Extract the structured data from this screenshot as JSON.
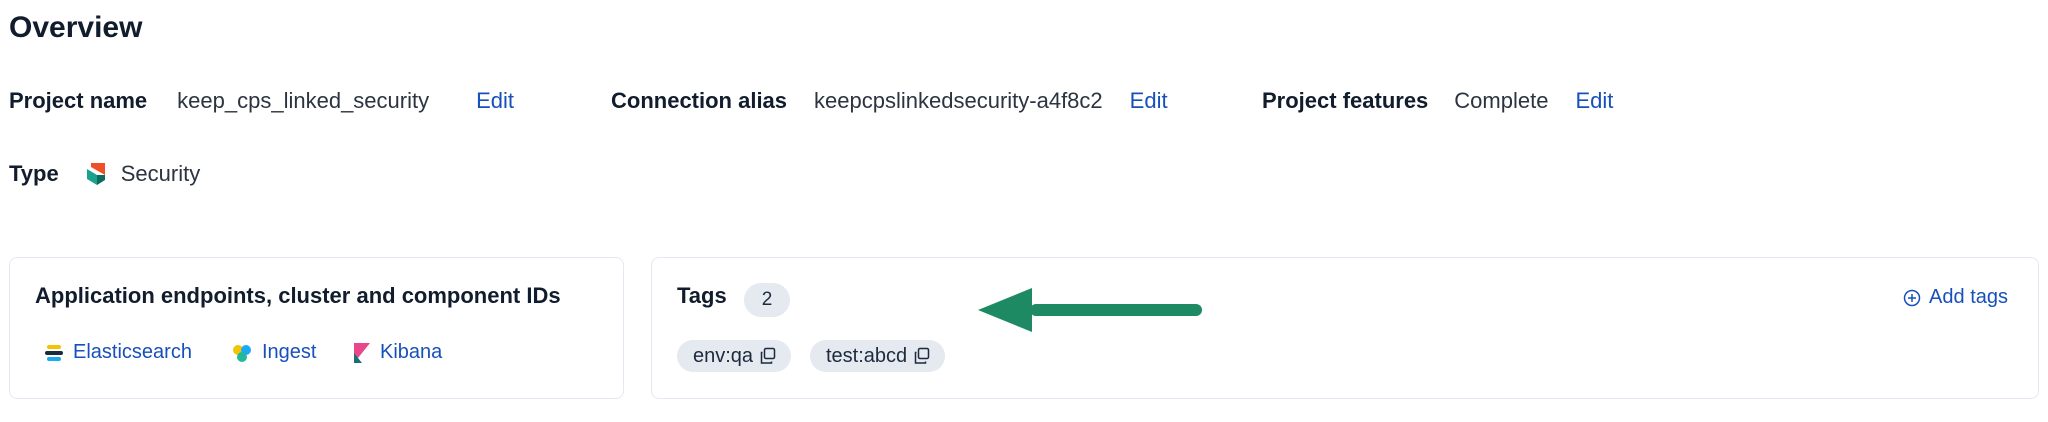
{
  "overview": {
    "title": "Overview"
  },
  "details": {
    "project_name_label": "Project name",
    "project_name_value": "keep_cps_linked_security",
    "connection_alias_label": "Connection alias",
    "connection_alias_value": "keepcpslinkedsecurity-a4f8c2",
    "project_features_label": "Project features",
    "project_features_value": "Complete",
    "edit_label": "Edit",
    "type_label": "Type",
    "type_value": "Security"
  },
  "endpoints_panel": {
    "title": "Application endpoints, cluster and component IDs",
    "items": [
      {
        "label": "Elasticsearch",
        "icon": "elasticsearch-icon"
      },
      {
        "label": "Ingest",
        "icon": "ingest-icon"
      },
      {
        "label": "Kibana",
        "icon": "kibana-icon"
      }
    ]
  },
  "tags_panel": {
    "title": "Tags",
    "count": "2",
    "add_label": "Add tags",
    "tags": [
      {
        "label": "env:qa"
      },
      {
        "label": "test:abcd"
      }
    ]
  },
  "colors": {
    "link": "#1750ba",
    "arrow": "#1e8a63",
    "badge_bg": "#e5e9f0",
    "panel_border": "#e3e8f2"
  }
}
